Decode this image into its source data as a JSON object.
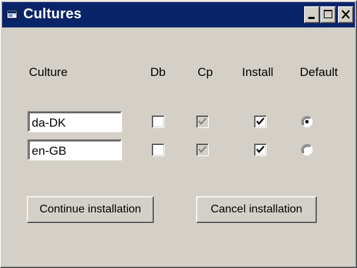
{
  "window": {
    "title": "Cultures"
  },
  "title_buttons": {
    "minimize_icon": "minimize-icon",
    "maximize_icon": "maximize-icon",
    "close_icon": "close-icon"
  },
  "headers": {
    "culture": "Culture",
    "db": "Db",
    "cp": "Cp",
    "install": "Install",
    "default": "Default"
  },
  "rows": [
    {
      "culture": "da-DK",
      "db": false,
      "cp": true,
      "install": true,
      "default": true
    },
    {
      "culture": "en-GB",
      "db": false,
      "cp": true,
      "install": true,
      "default": false
    }
  ],
  "buttons": {
    "continue": "Continue installation",
    "cancel": "Cancel installation"
  }
}
